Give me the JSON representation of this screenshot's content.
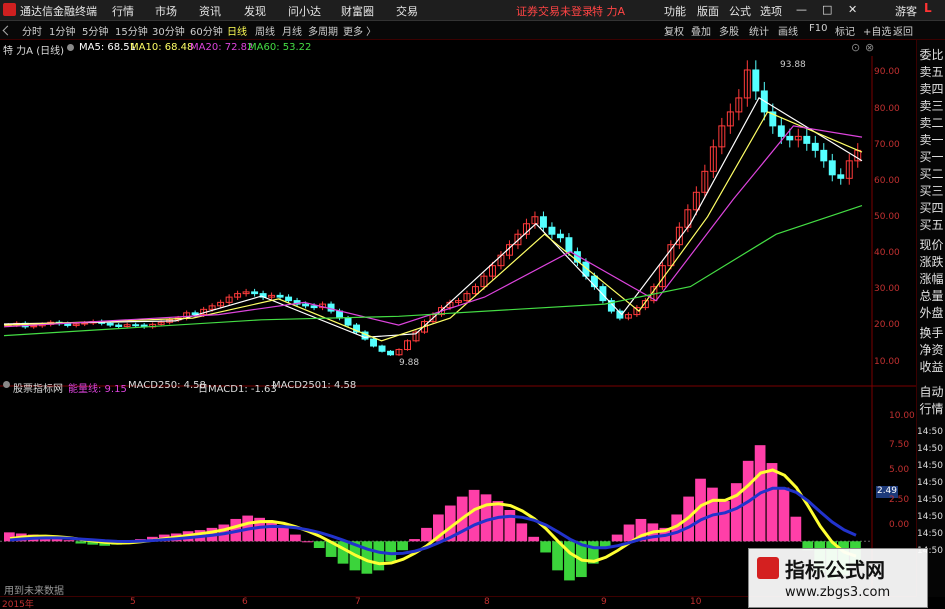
{
  "app": {
    "title": "通达信金融终端",
    "account_status": "证券交易未登录",
    "stock": "特 力A",
    "guest": "游客",
    "window_buttons": [
      "—",
      "□",
      "✕"
    ]
  },
  "menu": {
    "items": [
      "行情",
      "市场",
      "资讯",
      "发现",
      "问小达",
      "财富圈",
      "交易"
    ],
    "right_items": [
      "功能",
      "版面",
      "公式",
      "选项"
    ]
  },
  "toolbar": {
    "periods": [
      "分时",
      "1分钟",
      "5分钟",
      "15分钟",
      "30分钟",
      "60分钟",
      "日线",
      "周线",
      "月线",
      "多周期",
      "更多 〉"
    ],
    "active_index": 6,
    "right_items": [
      "复权",
      "叠加",
      "多股",
      "统计",
      "画线",
      "F10",
      "标记",
      "+自选",
      "返回"
    ]
  },
  "main_chart": {
    "name": "特 力A (日线)",
    "ma": [
      {
        "label": "MA5: 68.51",
        "color": "#ffffff"
      },
      {
        "label": "MA10: 68.48",
        "color": "#ffff66"
      },
      {
        "label": "MA20: 72.82",
        "color": "#dd44dd"
      },
      {
        "label": "MA60: 53.22",
        "color": "#44dd44"
      }
    ],
    "high_label": "93.88",
    "low_label": "9.88"
  },
  "indicator": {
    "name": "股票指标网",
    "line_label": "能量线: 9.15",
    "values": [
      {
        "label": "MACD250: 4.58",
        "color": "#ffffff"
      },
      {
        "label": "日MACD1: -1.63",
        "color": "#ffffff"
      },
      {
        "label": "MACD2501: 4.58",
        "color": "#ffffff"
      }
    ],
    "current_value": "2.49",
    "footer": "用到未来数据"
  },
  "sidebar": {
    "items": [
      "委比",
      "卖五",
      "卖四",
      "卖三",
      "卖二",
      "卖一",
      "买一",
      "买二",
      "买三",
      "买四",
      "买五",
      "现价",
      "涨跌",
      "涨幅",
      "总量",
      "外盘",
      "换手",
      "净资",
      "收益",
      "自动",
      "行情"
    ],
    "time_labels": [
      "14:50",
      "14:50",
      "14:50",
      "14:50",
      "14:50",
      "14:50",
      "14:50",
      "14:50"
    ],
    "top_tag": "L"
  },
  "axis": {
    "price_ticks": [
      "90.00",
      "80.00",
      "70.00",
      "60.00",
      "50.00",
      "40.00",
      "30.00",
      "20.00",
      "10.00"
    ],
    "macd_ticks": [
      "10.00",
      "7.50",
      "5.00",
      "2.50",
      "0.00"
    ],
    "months": [
      "2015年",
      "5",
      "6",
      "7",
      "8",
      "9",
      "10"
    ]
  },
  "chart_data": {
    "type": "candlestick",
    "price_range": [
      5,
      96
    ],
    "closes": [
      19,
      19.5,
      18.5,
      18.8,
      19.2,
      19.8,
      19.4,
      18.9,
      19.3,
      19.6,
      20.0,
      19.5,
      19.0,
      18.6,
      19.1,
      19.0,
      18.5,
      19.2,
      19.8,
      20.5,
      21.0,
      22.5,
      22.0,
      23.5,
      24.5,
      25.5,
      27.0,
      28.0,
      28.5,
      28.0,
      27.0,
      27.5,
      27.0,
      26.0,
      25.0,
      24.5,
      24.0,
      25.0,
      23.0,
      21.0,
      19.0,
      17.0,
      15.0,
      13.0,
      11.5,
      10.5,
      12.0,
      14.5,
      17.0,
      20.0,
      22.0,
      24.0,
      25.5,
      26.0,
      28.0,
      30.0,
      33.0,
      36.0,
      39.0,
      42.0,
      45.0,
      48.0,
      50.0,
      47.0,
      45.0,
      44.0,
      40.0,
      37.0,
      33.0,
      30.0,
      26.0,
      23.0,
      21.0,
      22.0,
      24.0,
      26.0,
      30.0,
      36.0,
      42.0,
      47.0,
      52.0,
      57.0,
      63.0,
      70.0,
      76.0,
      80.0,
      84.0,
      92.0,
      86.0,
      80.0,
      76.0,
      73.0,
      72.0,
      73.0,
      71.0,
      69.0,
      66.0,
      62.0,
      61.0,
      66.0,
      69.0
    ],
    "ma_series": [
      {
        "name": "MA5",
        "color": "#ffffff",
        "points": [
          [
            0,
            19.3
          ],
          [
            20,
            20.2
          ],
          [
            30,
            27.3
          ],
          [
            42,
            15.5
          ],
          [
            48,
            16.5
          ],
          [
            62,
            48.0
          ],
          [
            72,
            22.0
          ],
          [
            80,
            48.0
          ],
          [
            88,
            84.0
          ],
          [
            100,
            66.0
          ]
        ]
      },
      {
        "name": "MA10",
        "color": "#ffff66",
        "points": [
          [
            0,
            19.0
          ],
          [
            22,
            21.0
          ],
          [
            32,
            26.5
          ],
          [
            44,
            14.5
          ],
          [
            52,
            21.0
          ],
          [
            63,
            45.0
          ],
          [
            74,
            23.0
          ],
          [
            82,
            50.0
          ],
          [
            89,
            80.0
          ],
          [
            100,
            68.5
          ]
        ]
      },
      {
        "name": "MA20",
        "color": "#dd44dd",
        "points": [
          [
            0,
            18.5
          ],
          [
            25,
            22.0
          ],
          [
            35,
            25.5
          ],
          [
            46,
            19.0
          ],
          [
            56,
            27.0
          ],
          [
            66,
            40.0
          ],
          [
            76,
            26.0
          ],
          [
            85,
            55.0
          ],
          [
            92,
            76.0
          ],
          [
            100,
            72.8
          ]
        ]
      },
      {
        "name": "MA60",
        "color": "#44dd44",
        "points": [
          [
            0,
            16.0
          ],
          [
            30,
            20.5
          ],
          [
            46,
            21.5
          ],
          [
            70,
            25.0
          ],
          [
            80,
            30.0
          ],
          [
            90,
            45.0
          ],
          [
            100,
            53.2
          ]
        ]
      }
    ],
    "macd_range": [
      -4,
      13
    ],
    "macd_hist": [
      0.8,
      0.7,
      0.6,
      0.5,
      0.3,
      0.1,
      -0.2,
      -0.3,
      -0.4,
      -0.3,
      -0.1,
      0.2,
      0.4,
      0.6,
      0.7,
      0.9,
      1.0,
      1.2,
      1.5,
      2.0,
      2.3,
      2.1,
      1.8,
      1.2,
      0.6,
      0.0,
      -0.6,
      -1.4,
      -2.0,
      -2.6,
      -2.9,
      -2.6,
      -1.8,
      -0.8,
      0.2,
      1.2,
      2.4,
      3.2,
      4.0,
      4.6,
      4.2,
      3.6,
      2.8,
      1.6,
      0.4,
      -1.0,
      -2.6,
      -3.5,
      -3.2,
      -2.0,
      -0.6,
      0.6,
      1.5,
      2.0,
      1.6,
      1.2,
      2.4,
      4.0,
      5.6,
      4.8,
      3.6,
      5.2,
      7.2,
      8.6,
      7.0,
      4.8,
      2.2,
      -0.8,
      -2.8,
      -3.4,
      -3.0,
      -2.2
    ]
  }
}
